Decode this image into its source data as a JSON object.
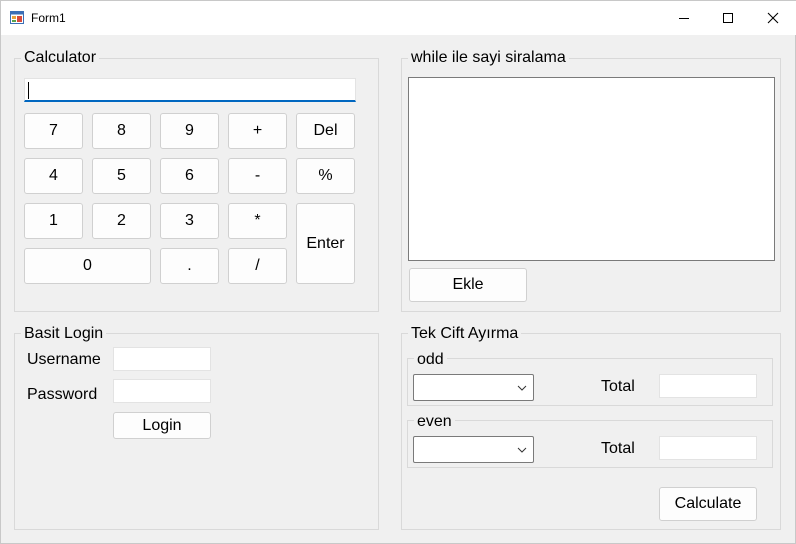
{
  "window": {
    "title": "Form1",
    "icon": "form-app-icon"
  },
  "calculator": {
    "group_label": "Calculator",
    "display_value": "",
    "keys": {
      "k7": "7",
      "k8": "8",
      "k9": "9",
      "plus": "+",
      "del": "Del",
      "k4": "4",
      "k5": "5",
      "k6": "6",
      "minus": "-",
      "percent": "%",
      "k1": "1",
      "k2": "2",
      "k3": "3",
      "multiply": "*",
      "enter": "Enter",
      "k0": "0",
      "dot": ".",
      "divide": "/"
    }
  },
  "sorting": {
    "group_label": "while ile sayi siralama",
    "add_label": "Ekle"
  },
  "login": {
    "group_label": "Basit Login",
    "username_label": "Username",
    "password_label": "Password",
    "username_value": "",
    "password_value": "",
    "login_label": "Login"
  },
  "oddeven": {
    "group_label": "Tek Cift Ayırma",
    "odd_label": "odd",
    "even_label": "even",
    "odd_total_label": "Total",
    "even_total_label": "Total",
    "calculate_label": "Calculate"
  },
  "colors": {
    "accent": "#0067c0",
    "background": "#f0f0f0",
    "border": "#d9d9d9"
  }
}
